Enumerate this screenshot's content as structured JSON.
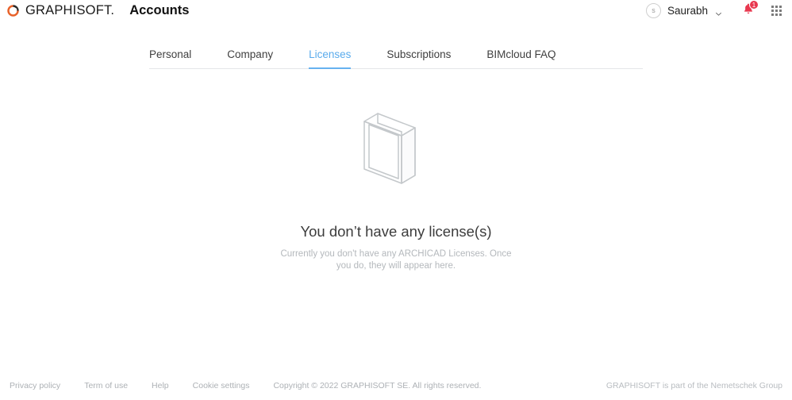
{
  "header": {
    "logo_icon": "graphisoft-circle-logo",
    "brand_name": "GRAPHISOFT.",
    "app_title": "Accounts",
    "user": {
      "avatar_initial": "s",
      "name": "Saurabh",
      "chevron_icon": "chevron-down-icon"
    },
    "notifications": {
      "icon": "bell-icon",
      "count": "1"
    },
    "apps_icon": "apps-grid-icon"
  },
  "tabs": [
    {
      "label": "Personal",
      "active": false
    },
    {
      "label": "Company",
      "active": false
    },
    {
      "label": "Licenses",
      "active": true
    },
    {
      "label": "Subscriptions",
      "active": false
    },
    {
      "label": "BIMcloud FAQ",
      "active": false
    }
  ],
  "empty_state": {
    "illustration_icon": "empty-binder-box-icon",
    "title": "You don’t have any license(s)",
    "subtitle": "Currently you don't have any ARCHICAD Licenses. Once you do, they will appear here."
  },
  "footer": {
    "links": [
      "Privacy policy",
      "Term of use",
      "Help",
      "Cookie settings"
    ],
    "copyright": "Copyright © 2022 GRAPHISOFT SE. All rights reserved.",
    "group_note": "GRAPHISOFT is part of the Nemetschek Group"
  },
  "colors": {
    "accent_blue": "#66b2f0",
    "badge_red": "#e8384f",
    "logo_orange": "#e8622a",
    "muted_text": "#adb1b5"
  }
}
